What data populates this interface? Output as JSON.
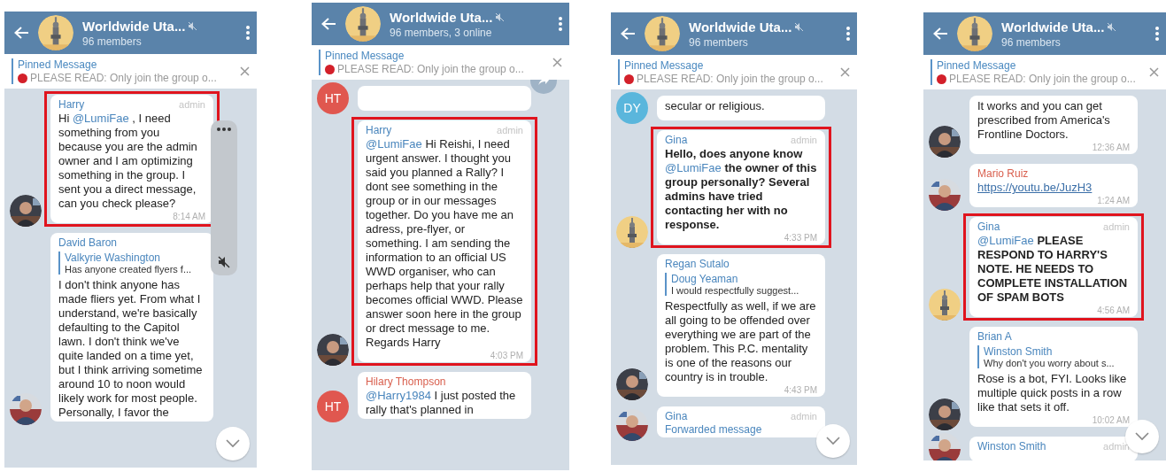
{
  "phones": [
    {
      "header": {
        "title": "Worldwide Uta...",
        "subtitle": "96 members"
      },
      "pinned": {
        "label": "Pinned Message",
        "text": "PLEASE READ:  Only join the group o..."
      },
      "overlays": [
        {
          "kind": "side_panel"
        },
        {
          "kind": "scroll_down"
        }
      ],
      "messages": [
        {
          "sender": "Harry",
          "color": "#4a86bd",
          "badge": "admin",
          "parts": [
            {
              "kind": "text",
              "text": "Hi "
            },
            {
              "kind": "mention",
              "text": "@LumiFae"
            },
            {
              "kind": "text",
              "text": " , I need something from you because you are the admin owner and I am optimizing something in the group. I sent you a direct message, can you check please?"
            }
          ],
          "time": "8:14 AM",
          "bold": false,
          "highlighted": true,
          "avatar": {
            "kind": "picture"
          }
        },
        {
          "sender": "David Baron",
          "color": "#4a86bd",
          "reply": {
            "name": "Valkyrie Washington",
            "text": "Has anyone created flyers f..."
          },
          "parts": [
            {
              "kind": "text",
              "text": "I don't think anyone has made fliers yet. From what I understand, we're basically defaulting to the Capitol lawn. I don't think we've quite landed on a time yet, but I think arriving sometime around 10 to noon would likely work for most people. Personally, I favor the"
            }
          ],
          "bold": false,
          "highlighted": false,
          "avatar": {
            "kind": "picture"
          }
        }
      ]
    },
    {
      "header": {
        "title": "Worldwide Uta...",
        "subtitle": "96 members, 3 online"
      },
      "pinned": {
        "label": "Pinned Message",
        "text": "PLEASE READ:  Only join the group o..."
      },
      "overlays": [
        {
          "kind": "forward"
        }
      ],
      "messages": [
        {
          "bold": false,
          "highlighted": false,
          "avatar": {
            "kind": "initials",
            "text": "HT",
            "color": "#e0574f"
          }
        },
        {
          "sender": "Harry",
          "color": "#4a86bd",
          "badge": "admin",
          "parts": [
            {
              "kind": "mention",
              "text": "@LumiFae"
            },
            {
              "kind": "text",
              "text": " Hi Reishi, I need urgent answer. I thought you said you planned a Rally? I dont see something in the group or in our messages together. Do you have me an adress, pre-flyer, or something. I am sending the information to an official US WWD organiser, who can perhaps help that your rally becomes official WWD. Please answer soon here in the group or drect message to me. Regards Harry"
            }
          ],
          "time": "4:03 PM",
          "bold": false,
          "highlighted": true,
          "avatar": {
            "kind": "picture"
          }
        },
        {
          "sender": "Hilary Thompson",
          "color": "#d9604f",
          "parts": [
            {
              "kind": "mention",
              "text": "@Harry1984"
            },
            {
              "kind": "text",
              "text": " I just posted the rally that's planned in"
            }
          ],
          "bold": false,
          "highlighted": false,
          "avatar": {
            "kind": "initials",
            "text": "HT",
            "color": "#e0574f"
          }
        }
      ]
    },
    {
      "header": {
        "title": "Worldwide Uta...",
        "subtitle": "96 members"
      },
      "pinned": {
        "label": "Pinned Message",
        "text": "PLEASE READ:  Only join the group o..."
      },
      "overlays": [
        {
          "kind": "scroll_down"
        }
      ],
      "messages": [
        {
          "parts": [
            {
              "kind": "text",
              "text": "secular or religious."
            }
          ],
          "bold": false,
          "highlighted": false,
          "avatar": {
            "kind": "initials",
            "text": "DY",
            "color": "#5ab6dc"
          }
        },
        {
          "sender": "Gina",
          "color": "#4a86bd",
          "badge": "admin",
          "parts": [
            {
              "kind": "text",
              "text": "Hello, does anyone know "
            },
            {
              "kind": "mention",
              "text": "@LumiFae"
            },
            {
              "kind": "text",
              "text": " the owner of this group personally? Several admins have tried contacting her with no response."
            }
          ],
          "time": "4:33 PM",
          "bold": true,
          "highlighted": true,
          "avatar": {
            "kind": "picture"
          }
        },
        {
          "sender": "Regan Sutalo",
          "color": "#4a86bd",
          "reply": {
            "name": "Doug Yeaman",
            "text": "I would respectfully suggest..."
          },
          "parts": [
            {
              "kind": "text",
              "text": "Respectfully as well, if we are all going to be offended over everything we are part of the problem. This P.C. mentality is one of the reasons our country is in trouble."
            }
          ],
          "time": "4:43 PM",
          "bold": false,
          "highlighted": false,
          "avatar": {
            "kind": "picture"
          }
        },
        {
          "sender": "Gina",
          "color": "#4a86bd",
          "badge": "admin",
          "forwarded": "Forwarded message",
          "bold": false,
          "highlighted": false,
          "avatar": {
            "kind": "picture"
          }
        }
      ]
    },
    {
      "header": {
        "title": "Worldwide Uta...",
        "subtitle": "96 members"
      },
      "pinned": {
        "label": "Pinned Message",
        "text": "PLEASE READ:  Only join the group o..."
      },
      "overlays": [
        {
          "kind": "scroll_down"
        }
      ],
      "messages": [
        {
          "parts": [
            {
              "kind": "text",
              "text": "It works and you can get prescribed from America's Frontline Doctors."
            }
          ],
          "time": "12:36 AM",
          "bold": false,
          "highlighted": false,
          "avatar": {
            "kind": "picture"
          }
        },
        {
          "sender": "Mario Ruiz",
          "color": "#d9604f",
          "parts": [
            {
              "kind": "link",
              "text": "https://youtu.be/JuzH3"
            }
          ],
          "time": "1:24 AM",
          "bold": false,
          "highlighted": false,
          "avatar": {
            "kind": "picture"
          }
        },
        {
          "sender": "Gina",
          "color": "#4a86bd",
          "badge": "admin",
          "parts": [
            {
              "kind": "mention",
              "text": "@LumiFae"
            },
            {
              "kind": "text",
              "text": " PLEASE RESPOND TO HARRY'S NOTE. HE NEEDS TO COMPLETE INSTALLATION OF SPAM BOTS"
            }
          ],
          "time": "4:56 AM",
          "bold": true,
          "highlighted": true,
          "avatar": {
            "kind": "picture"
          }
        },
        {
          "sender": "Brian A",
          "color": "#4a86bd",
          "reply": {
            "name": "Winston Smith",
            "text": "Why don't you worry about s..."
          },
          "parts": [
            {
              "kind": "text",
              "text": "Rose is a bot, FYI. Looks like multiple quick posts in a row like that sets it off."
            }
          ],
          "time": "10:02 AM",
          "bold": false,
          "highlighted": false,
          "avatar": {
            "kind": "picture"
          }
        },
        {
          "sender": "Winston Smith",
          "color": "#4a86bd",
          "badge": "admin",
          "bold": false,
          "highlighted": false,
          "avatar": {
            "kind": "picture"
          }
        }
      ]
    }
  ]
}
